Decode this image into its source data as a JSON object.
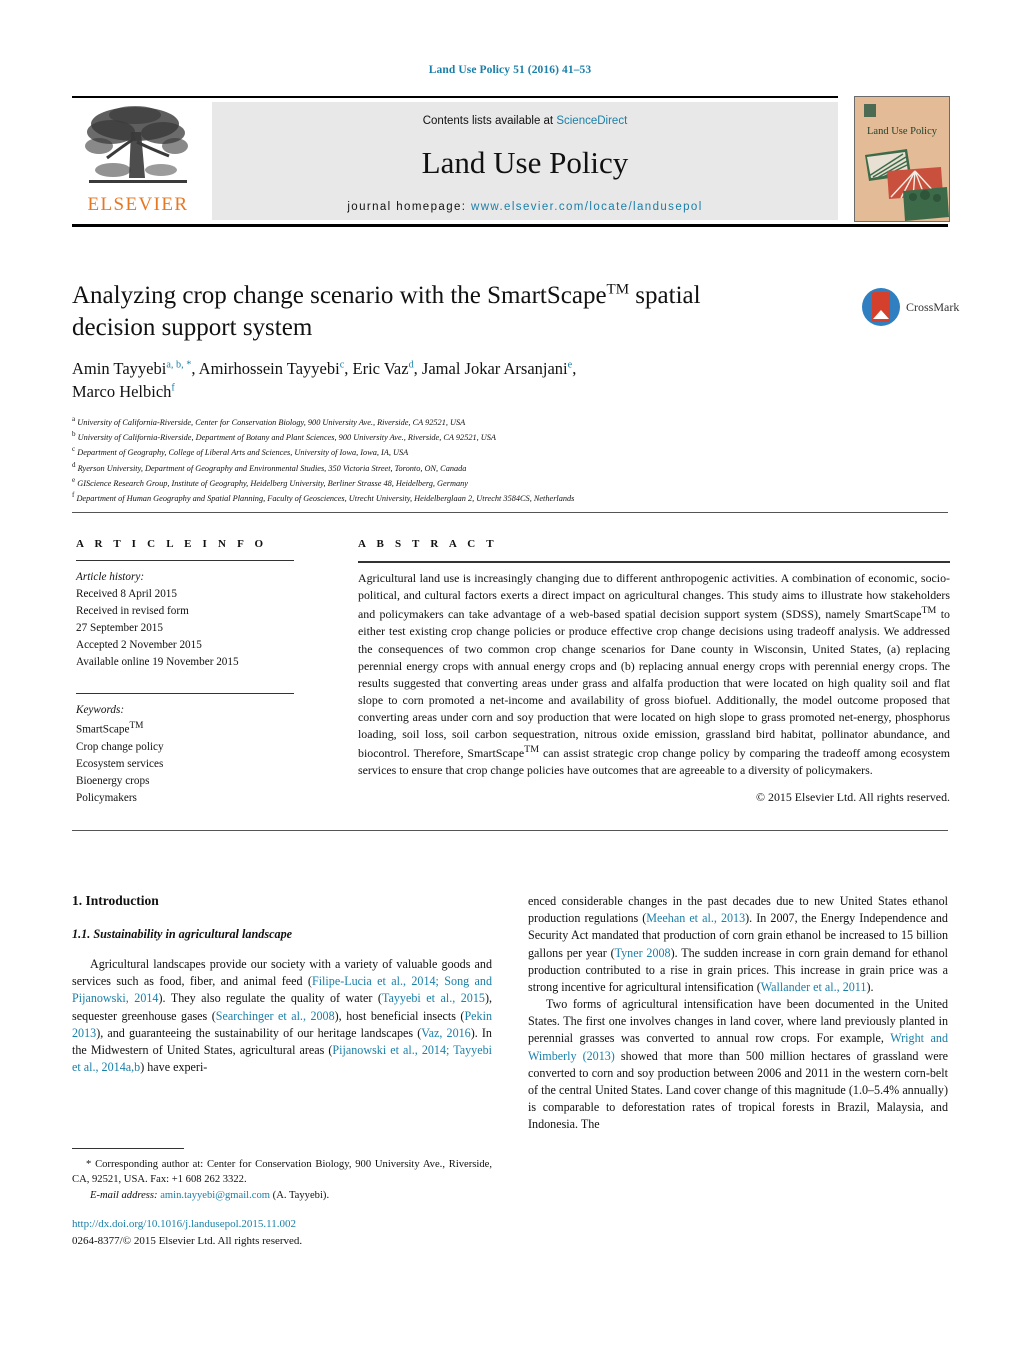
{
  "running_head": "Land Use Policy 51 (2016) 41–53",
  "masthead": {
    "contents_prefix": "Contents lists available at ",
    "contents_link": "ScienceDirect",
    "journal_title": "Land Use Policy",
    "homepage_prefix": "journal homepage: ",
    "homepage_url": "www.elsevier.com/locate/landusepol",
    "publisher": "ELSEVIER",
    "cover_title": "Land Use Policy",
    "accent_orange": "#E87722",
    "link_blue": "#1a7fa8"
  },
  "article": {
    "title_part1": "Analyzing crop change scenario with the SmartScape",
    "title_tm": "TM",
    "title_part2": " spatial decision support system",
    "crossmark_label": "CrossMark",
    "authors_line1_a": "Amin Tayyebi",
    "authors_line1_a_sup": "a, b, *",
    "authors_line1_b": ", Amirhossein Tayyebi",
    "authors_line1_b_sup": "c",
    "authors_line1_c": ", Eric Vaz",
    "authors_line1_c_sup": "d",
    "authors_line1_d": ", Jamal Jokar Arsanjani",
    "authors_line1_d_sup": "e",
    "authors_line1_end": ",",
    "authors_line2": "Marco Helbich",
    "authors_line2_sup": "f",
    "affiliations": [
      {
        "mark": "a",
        "text": "University of California-Riverside, Center for Conservation Biology, 900 University Ave., Riverside, CA 92521, USA"
      },
      {
        "mark": "b",
        "text": "University of California-Riverside, Department of Botany and Plant Sciences, 900 University Ave., Riverside, CA 92521, USA"
      },
      {
        "mark": "c",
        "text": "Department of Geography, College of Liberal Arts and Sciences, University of Iowa, Iowa, IA, USA"
      },
      {
        "mark": "d",
        "text": "Ryerson University, Department of Geography and Environmental Studies, 350 Victoria Street, Toronto, ON, Canada"
      },
      {
        "mark": "e",
        "text": "GIScience Research Group, Institute of Geography, Heidelberg University, Berliner Strasse 48, Heidelberg, Germany"
      },
      {
        "mark": "f",
        "text": "Department of Human Geography and Spatial Planning, Faculty of Geosciences, Utrecht University, Heidelberglaan 2, Utrecht 3584CS, Netherlands"
      }
    ]
  },
  "article_info": {
    "heading": "A R T I C L E   I N F O",
    "history_label": "Article history:",
    "history": [
      "Received 8 April 2015",
      "Received in revised form",
      "27 September 2015",
      "Accepted 2 November 2015",
      "Available online 19 November 2015"
    ],
    "keywords_label": "Keywords:",
    "keywords_first": "SmartScape",
    "keywords_first_tm": "TM",
    "keywords": [
      "Crop change policy",
      "Ecosystem services",
      "Bioenergy crops",
      "Policymakers"
    ]
  },
  "abstract": {
    "heading": "A B S T R A C T",
    "p1": "Agricultural land use is increasingly changing due to different anthropogenic activities. A combination of economic, socio-political, and cultural factors exerts a direct impact on agricultural changes. This study aims to illustrate how stakeholders and policymakers can take advantage of a web-based spatial decision support system (SDSS), namely SmartScape",
    "tm1": "TM",
    "p2": " to either test existing crop change policies or produce effective crop change decisions using tradeoff analysis. We addressed the consequences of two common crop change scenarios for Dane county in Wisconsin, United States, (a) replacing perennial energy crops with annual energy crops and (b) replacing annual energy crops with perennial energy crops. The results suggested that converting areas under grass and alfalfa production that were located on high quality soil and flat slope to corn promoted a net-income and availability of gross biofuel. Additionally, the model outcome proposed that converting areas under corn and soy production that were located on high slope to grass promoted net-energy, phosphorus loading, soil loss, soil carbon sequestration, nitrous oxide emission, grassland bird habitat, pollinator abundance, and biocontrol. Therefore, SmartScape",
    "tm2": "TM",
    "p3": " can assist strategic crop change policy by comparing the tradeoff among ecosystem services to ensure that crop change policies have outcomes that are agreeable to a diversity of policymakers.",
    "copyright": "© 2015 Elsevier Ltd. All rights reserved."
  },
  "body": {
    "section_heading": "1.  Introduction",
    "subsection_heading": "1.1.  Sustainability in agricultural landscape",
    "left_p1_a": "Agricultural landscapes provide our society with a variety of valuable goods and services such as food, fiber, and animal feed (",
    "left_cite1": "Filipe-Lucia et al., 2014; Song and Pijanowski, 2014",
    "left_p1_b": "). They also regulate the quality of water (",
    "left_cite2": "Tayyebi et al., 2015",
    "left_p1_c": "), sequester greenhouse gases (",
    "left_cite3": "Searchinger et al., 2008",
    "left_p1_d": "), host beneficial insects (",
    "left_cite4": "Pekin 2013",
    "left_p1_e": "), and guaranteeing the sustainability of our heritage landscapes (",
    "left_cite5": "Vaz, 2016",
    "left_p1_f": "). In the Midwestern of United States, agricultural areas (",
    "left_cite6": "Pijanowski et al., 2014; Tayyebi et al., 2014a,b",
    "left_p1_g": ") have experi-",
    "right_p1_a": "enced considerable changes in the past decades due to new United States ethanol production regulations (",
    "right_cite1": "Meehan et al., 2013",
    "right_p1_b": "). In 2007, the Energy Independence and Security Act mandated that production of corn grain ethanol be increased to 15 billion gallons per year (",
    "right_cite2": "Tyner 2008",
    "right_p1_c": "). The sudden increase in corn grain demand for ethanol production contributed to a rise in grain prices. This increase in grain price was a strong incentive for agricultural intensification (",
    "right_cite3": "Wallander et al., 2011",
    "right_p1_d": ").",
    "right_p2_a": "Two forms of agricultural intensification have been documented in the United States. The first one involves changes in land cover, where land previously planted in perennial grasses was converted to annual row crops. For example, ",
    "right_cite4": "Wright and Wimberly (2013)",
    "right_p2_b": " showed that more than 500 million hectares of grassland were converted to corn and soy production between 2006 and 2011 in the western corn-belt of the central United States. Land cover change of this magnitude (1.0–5.4% annually) is comparable to deforestation rates of tropical forests in Brazil, Malaysia, and Indonesia. The"
  },
  "footer": {
    "corresponding_marker": "*",
    "corresponding_text": " Corresponding author at: Center for Conservation Biology, 900 University Ave., Riverside, CA, 92521, USA. Fax: +1 608 262 3322.",
    "email_label": "E-mail address:",
    "email_link": "amin.tayyebi@gmail.com",
    "email_suffix": " (A. Tayyebi).",
    "doi": "http://dx.doi.org/10.1016/j.landusepol.2015.11.002",
    "issn_line": "0264-8377/© 2015 Elsevier Ltd. All rights reserved."
  }
}
